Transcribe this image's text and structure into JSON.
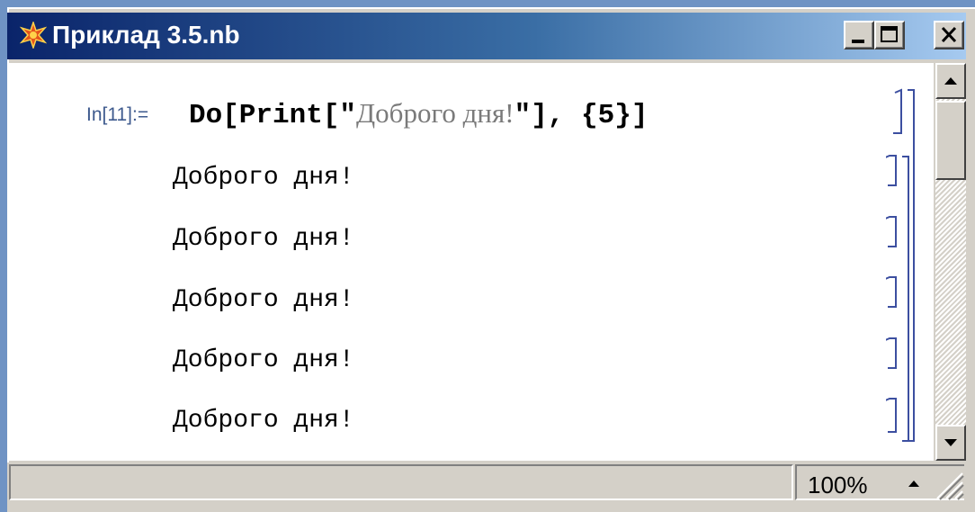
{
  "window": {
    "title": "Приклад 3.5.nb"
  },
  "notebook": {
    "input_label": "In[11]:=",
    "input_code": {
      "part1": "Do[Print[\"",
      "string": "Доброго дня!",
      "part2": "\"], {5}]"
    },
    "outputs": [
      "Доброго дня!",
      "Доброго дня!",
      "Доброго дня!",
      "Доброго дня!",
      "Доброго дня!"
    ]
  },
  "statusbar": {
    "zoom": "100%"
  },
  "colors": {
    "title_gradient_start": "#0a246a",
    "title_gradient_end": "#a6caf0",
    "cell_bracket": "#3c4fa0",
    "input_label": "#3e5a8e"
  },
  "icons": [
    "mathematica-icon",
    "minimize-icon",
    "maximize-icon",
    "close-icon",
    "scroll-up-icon",
    "scroll-down-icon",
    "zoom-up-icon",
    "resize-grip-icon"
  ]
}
